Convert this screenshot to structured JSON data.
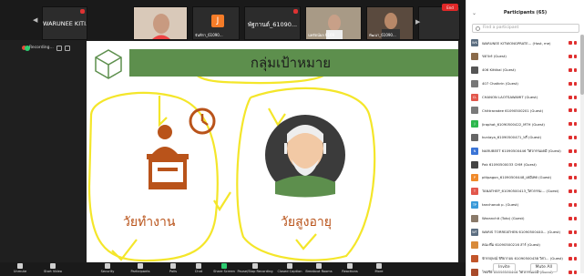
{
  "thumbnails": [
    {
      "name": "WARUNEE KITI...",
      "type": "text"
    },
    {
      "name": "",
      "type": "video"
    },
    {
      "name": "จันทิรา_61090...",
      "letter": "J",
      "type": "letter"
    },
    {
      "name": "พัฐกานต์_61090...",
      "type": "text"
    },
    {
      "name": "นพรัตน์ผล 6109",
      "type": "video"
    },
    {
      "name": "ทัฒนา_61090...",
      "type": "video"
    },
    {
      "name": "",
      "type": "empty"
    }
  ],
  "recording": {
    "label": "Recording..."
  },
  "slide": {
    "title": "กลุ่มเป้าหมาย",
    "label_left": "วัยทำงาน",
    "label_right": "วัยสูงอายุ"
  },
  "panel": {
    "title": "Participants (65)",
    "search_placeholder": "Find a participant",
    "participants": [
      {
        "initials": "WK",
        "color": "#5b6d80",
        "name": "WARUNEE KITWONGPRATE... (Host, me)"
      },
      {
        "initials": "",
        "color": "#8a6a4a",
        "name": "ขยาพร (Guest)"
      },
      {
        "initials": "",
        "color": "#555",
        "name": "406 Kittikal (Guest)"
      },
      {
        "initials": "",
        "color": "#777",
        "name": "407 Chatkrin (Guest)"
      },
      {
        "initials": "CL",
        "color": "#e2574c",
        "name": "CHANON LAOTSAWAMIT (Guest)"
      },
      {
        "initials": "",
        "color": "#7a7a7a",
        "name": "Chittraradee 61090500201 (Guest)"
      },
      {
        "initials": "J",
        "color": "#2db84d",
        "name": "Jiraphat_61090500422_MTH (Guest)"
      },
      {
        "initials": "",
        "color": "#666",
        "name": "kunlaya_61090500471_พรี่ (Guest)"
      },
      {
        "initials": "N",
        "color": "#3a74d6",
        "name": "NARUBEET 61090500446 วิศวกรรมเคมี (Guest)"
      },
      {
        "initials": "",
        "color": "#444",
        "name": "Pak 61090500033 CHM (Guest)"
      },
      {
        "initials": "P",
        "color": "#f08a2a",
        "name": "pitipagon_61090500448_เคมีเทค (Guest)"
      },
      {
        "initials": "T",
        "color": "#e2574c",
        "name": "TANATHEP_61090500413_วิศวกรรม... (Guest)"
      },
      {
        "initials": "TP",
        "color": "#3a9ad9",
        "name": "tanchanok p. (Guest)"
      },
      {
        "initials": "",
        "color": "#8a7a6a",
        "name": "Waranchit (Toto) (Guest)"
      },
      {
        "initials": "WT",
        "color": "#5b6d80",
        "name": "WARIS TORREATHEN 61090500440... (Guest)"
      },
      {
        "initials": "",
        "color": "#d88a3a",
        "name": "คณะที่ม 61090500216 สาร์ (Guest)"
      },
      {
        "initials": "",
        "color": "#c2552a",
        "name": "จักรกฤษณ์ พิริยากอบ 61090500438 วิศว... (Guest)"
      },
      {
        "initials": "",
        "color": "#a84a2a",
        "name": "ไชตรีษ์ 61090500444 วิศวกรรมเคมี (Guest)"
      }
    ],
    "invite": "Invite",
    "mute_all": "Mute All"
  },
  "toolbar": {
    "items": [
      "Unmute",
      "Start Video",
      "Security",
      "Participants",
      "Polls",
      "Chat",
      "Share Screen",
      "Pause/Stop Recording",
      "Closed Caption",
      "Breakout Rooms",
      "Reactions",
      "More"
    ],
    "end": "End"
  }
}
